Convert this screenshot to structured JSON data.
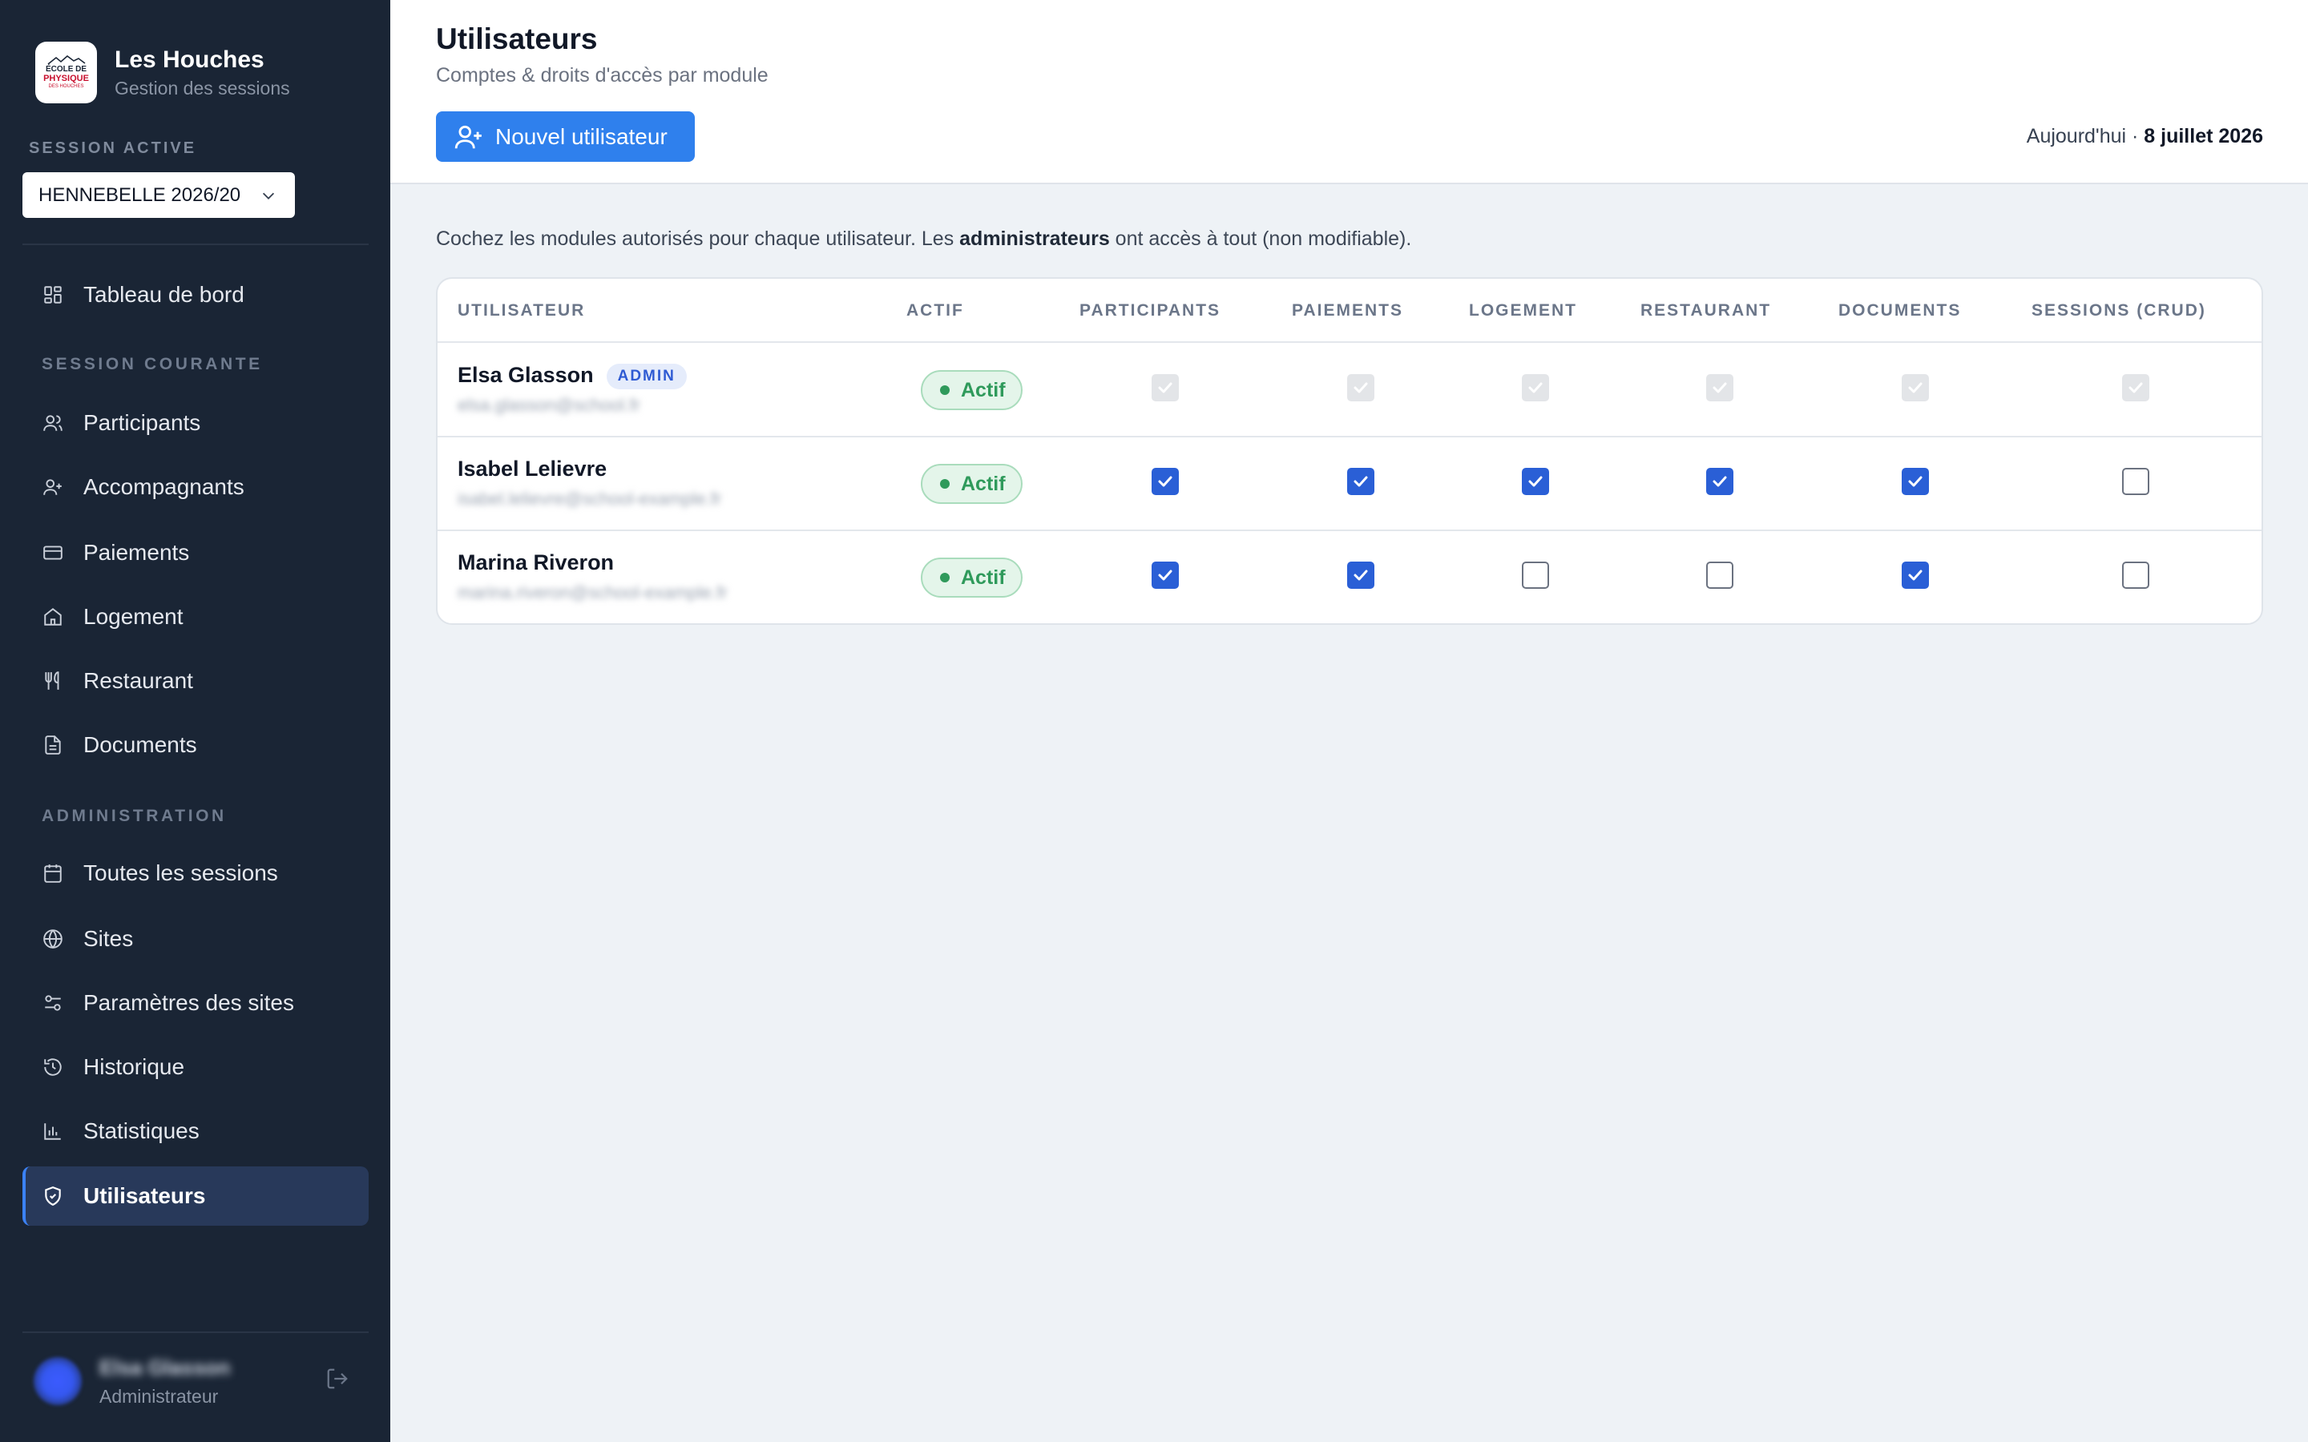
{
  "brand": {
    "title": "Les Houches",
    "subtitle": "Gestion des sessions",
    "logo_lines": [
      "ÉCOLE DE",
      "PHYSIQUE",
      "DES HOUCHES"
    ]
  },
  "session": {
    "label": "SESSION ACTIVE",
    "selected": "HENNEBELLE 2026/20"
  },
  "nav": {
    "dashboard": "Tableau de bord",
    "section_current": "SESSION COURANTE",
    "participants": "Participants",
    "accompagnants": "Accompagnants",
    "paiements": "Paiements",
    "logement": "Logement",
    "restaurant": "Restaurant",
    "documents": "Documents",
    "section_admin": "ADMINISTRATION",
    "sessions": "Toutes les sessions",
    "sites": "Sites",
    "site_params": "Paramètres des sites",
    "history": "Historique",
    "stats": "Statistiques",
    "users": "Utilisateurs"
  },
  "current_user": {
    "name": "Elsa Glasson",
    "role": "Administrateur"
  },
  "header": {
    "title": "Utilisateurs",
    "subtitle": "Comptes & droits d'accès par module",
    "new_button": "Nouvel utilisateur",
    "today_prefix": "Aujourd'hui · ",
    "today_date": "8 juillet 2026"
  },
  "intro": {
    "text_1": "Cochez les modules autorisés pour chaque utilisateur. Les ",
    "bold": "administrateurs",
    "text_2": " ont accès à tout (non modifiable)."
  },
  "table": {
    "columns": [
      "UTILISATEUR",
      "ACTIF",
      "PARTICIPANTS",
      "PAIEMENTS",
      "LOGEMENT",
      "RESTAURANT",
      "DOCUMENTS",
      "SESSIONS (CRUD)"
    ],
    "rows": [
      {
        "name": "Elsa Glasson",
        "badge": "ADMIN",
        "email": "elsa.glasson@school.fr",
        "status": "Actif",
        "perms": [
          "disabled",
          "disabled",
          "disabled",
          "disabled",
          "disabled",
          "disabled"
        ]
      },
      {
        "name": "Isabel Lelievre",
        "badge": "",
        "email": "isabel.lelievre@school-example.fr",
        "status": "Actif",
        "perms": [
          "on",
          "on",
          "on",
          "on",
          "on",
          "off"
        ]
      },
      {
        "name": "Marina Riveron",
        "badge": "",
        "email": "marina.riveron@school-example.fr",
        "status": "Actif",
        "perms": [
          "on",
          "on",
          "off",
          "off",
          "on",
          "off"
        ]
      }
    ]
  },
  "colors": {
    "sidebar_bg": "#1a2535",
    "accent": "#2f80ed",
    "checkbox_on": "#2a5fd6",
    "status_green": "#2f9a5b"
  }
}
